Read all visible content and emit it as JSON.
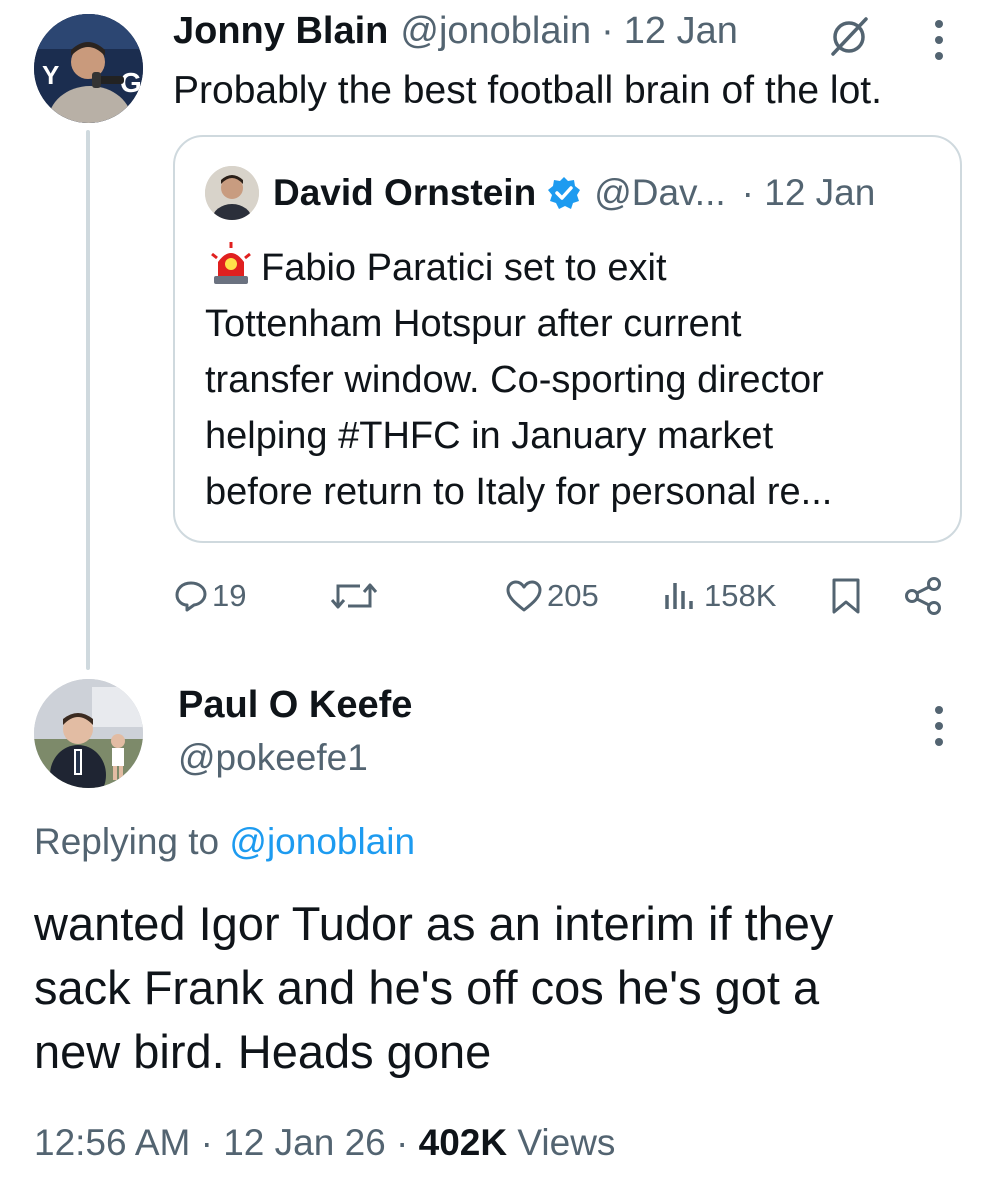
{
  "thread_tweet": {
    "author_name": "Jonny Blain",
    "handle": "@jonoblain",
    "separator": "·",
    "date": "12 Jan",
    "text": "Probably the best football brain of the lot.",
    "avatar_icon": "avatar-jonny-blain-icon"
  },
  "quoted_tweet": {
    "author_name": "David Ornstein",
    "verified_icon": "verified-badge-icon",
    "handle": "@Dav...",
    "date": "· 12 Jan",
    "siren_icon": "police-siren-emoji",
    "text": "Fabio Paratici set to exit\nTottenham Hotspur after current\ntransfer window. Co-sporting director\nhelping #THFC in January market\nbefore return to Italy for personal re..."
  },
  "actions": {
    "replies": "19",
    "likes": "205",
    "views": "158K"
  },
  "reply": {
    "author_name": "Paul O Keefe",
    "handle": "@pokeefe1",
    "replying_prefix": "Replying to",
    "replying_to": "@jonoblain",
    "text": "wanted Igor Tudor as an interim if they\nsack Frank and he's off cos he's got a\nnew bird. Heads gone",
    "time": "12:56 AM",
    "sep1": "·",
    "date": "12 Jan 26",
    "sep2": "·",
    "views_count": "402K",
    "views_label": "Views"
  },
  "colors": {
    "text": "#0f1419",
    "muted": "#536471",
    "link": "#1d9bf0",
    "border": "#cfd9de"
  }
}
